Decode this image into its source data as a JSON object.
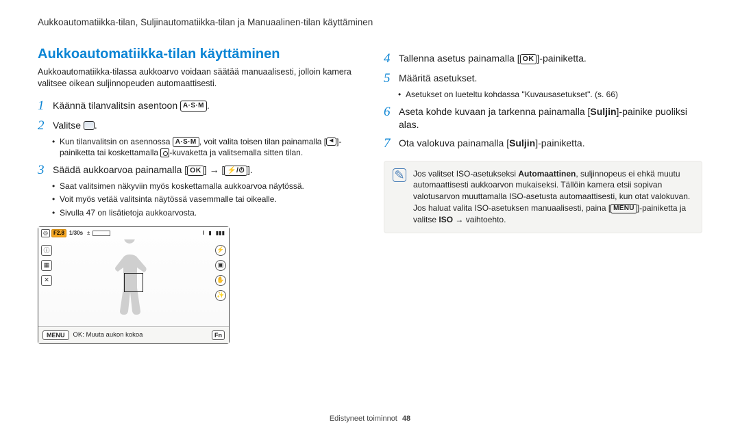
{
  "header": "Aukkoautomatiikka-tilan, Suljinautomatiikka-tilan ja Manuaalinen-tilan käyttäminen",
  "left": {
    "title": "Aukkoautomatiikka-tilan käyttäminen",
    "intro": "Aukkoautomatiikka-tilassa aukkoarvo voidaan säätää manuaalisesti, jolloin kamera valitsee oikean suljinnopeuden automaattisesti.",
    "step1": "Käännä tilanvalitsin asentoon ",
    "step2": "Valitse ",
    "step2_sub_a": "Kun tilanvalitsin on asennossa ",
    "step2_sub_b": ", voit valita toisen tilan painamalla [",
    "step2_sub_c": "]-painiketta tai koskettamalla ",
    "step2_sub_d": "-kuvaketta ja valitsemalla sitten tilan.",
    "step3": "Säädä aukkoarvoa painamalla [",
    "step3_mid": "] → [",
    "step3_end": "].",
    "step3_b1": "Saat valitsimen näkyviin myös koskettamalla aukkoarvoa näytössä.",
    "step3_b2": "Voit myös vetää valitsinta näytössä vasemmalle tai oikealle.",
    "step3_b3": "Sivulla 47 on lisätietoja aukkoarvosta."
  },
  "right": {
    "step4_a": "Tallenna asetus painamalla [",
    "step4_b": "]-painiketta.",
    "step5": "Määritä asetukset.",
    "step5_b1": "Asetukset on lueteltu kohdassa \"Kuvausasetukset\". (s. 66)",
    "step6_a": "Aseta kohde kuvaan ja tarkenna painamalla [",
    "step6_b": "Suljin",
    "step6_c": "]-painike puoliksi alas.",
    "step7_a": "Ota valokuva painamalla [",
    "step7_b": "Suljin",
    "step7_c": "]-painiketta.",
    "note_a": "Jos valitset ISO-asetukseksi ",
    "note_b": "Automaattinen",
    "note_c": ", suljinnopeus ei ehkä muutu automaattisesti aukkoarvon mukaiseksi. Tällöin kamera etsii sopivan valotusarvon muuttamalla ISO-asetusta automaattisesti, kun otat valokuvan. Jos haluat valita ISO-asetuksen manuaalisesti, paina [",
    "note_d": "]-painiketta ja valitse ",
    "note_e": "ISO",
    "note_f": " → vaihtoehto."
  },
  "lcd": {
    "fval": "F2.8",
    "shutter": "1/30s",
    "count": "I",
    "menu": "MENU",
    "fn": "Fn",
    "bottom_label": "OK: Muuta aukon kokoa"
  },
  "glyphs": {
    "ok": "OK",
    "menu": "MENU",
    "asm": "A·S·M",
    "flash_timer": "⚡/⏱",
    "arrow": "→",
    "pencil": "✎"
  },
  "footer": {
    "section": "Edistyneet toiminnot",
    "page": "48"
  }
}
